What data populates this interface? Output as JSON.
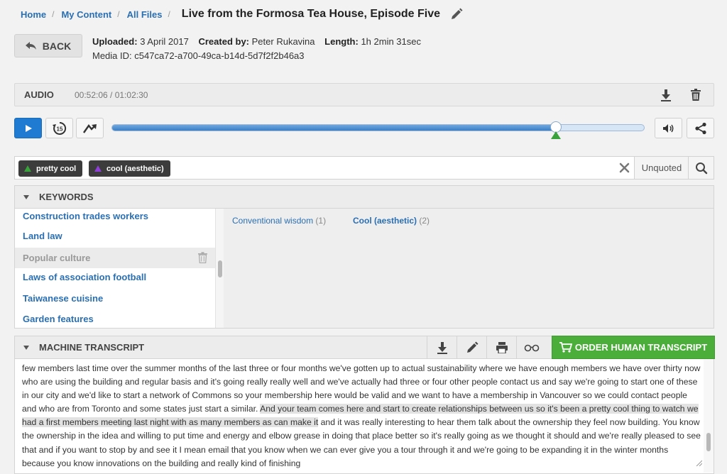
{
  "breadcrumb": {
    "items": [
      "Home",
      "My Content",
      "All Files"
    ],
    "separator": "/",
    "title": "Live from the Formosa Tea House, Episode Five"
  },
  "header": {
    "back_label": "BACK",
    "uploaded_label": "Uploaded:",
    "uploaded_value": "3 April 2017",
    "created_label": "Created by:",
    "created_value": "Peter Rukavina",
    "length_label": "Length:",
    "length_value": "1h 2min 31sec",
    "media_id_label": "Media ID:",
    "media_id_value": "c547ca72-a700-49ca-b14d-5d7f2f2b46a3"
  },
  "audio": {
    "label": "AUDIO",
    "time": "00:52:06 / 01:02:30",
    "progress_fraction": 0.834
  },
  "player": {
    "skip_back_label": "15"
  },
  "search": {
    "tags": [
      {
        "label": "pretty cool",
        "color": "#3aa23a"
      },
      {
        "label": "cool (aesthetic)",
        "color": "#8e3fd6"
      }
    ],
    "unquoted_label": "Unquoted"
  },
  "keywords": {
    "title": "KEYWORDS",
    "items": [
      {
        "label": "Construction trades workers"
      },
      {
        "label": "Land law"
      },
      {
        "label": "Popular culture"
      },
      {
        "label": "Laws of association football"
      },
      {
        "label": "Taiwanese cuisine"
      },
      {
        "label": "Garden features"
      }
    ],
    "selected_index": 2,
    "related": [
      {
        "label": "Conventional wisdom",
        "count": "(1)",
        "bold": false
      },
      {
        "label": "Cool (aesthetic)",
        "count": "(2)",
        "bold": true
      }
    ]
  },
  "transcript": {
    "title": "MACHINE TRANSCRIPT",
    "order_label": "ORDER HUMAN TRANSCRIPT",
    "text_before": "few members last time over the summer months of the last three or four months we've gotten up to actual sustainability where we have enough members we have over thirty now who are using the building and regular basis and it's going really really well and we've actually had three or four other people contact us and say we're going to start one of these in our city and we'd like to start a network of Commons so your membership here would be valid and we want to have a membership in Vancouver so we could contact people and who are from Toronto and some states just start a similar. ",
    "text_highlight": "And your team comes here and start to create relationships between us so it's been a pretty cool thing to watch we had a first members meeting last night with as many members as can make it",
    "text_after": " and it was really interesting to hear them talk about the ownership they feel now building. You know the ownership in the idea and willing to put time and energy and elbow grease in doing that place better so it's really going as we thought it should and we're really pleased to see that and if you want to stop by and see it I mean email that you know when we can ever give you a tour through it and we're going to be expanding it in the winter months because you know innovations on the building and really kind of finishing"
  }
}
